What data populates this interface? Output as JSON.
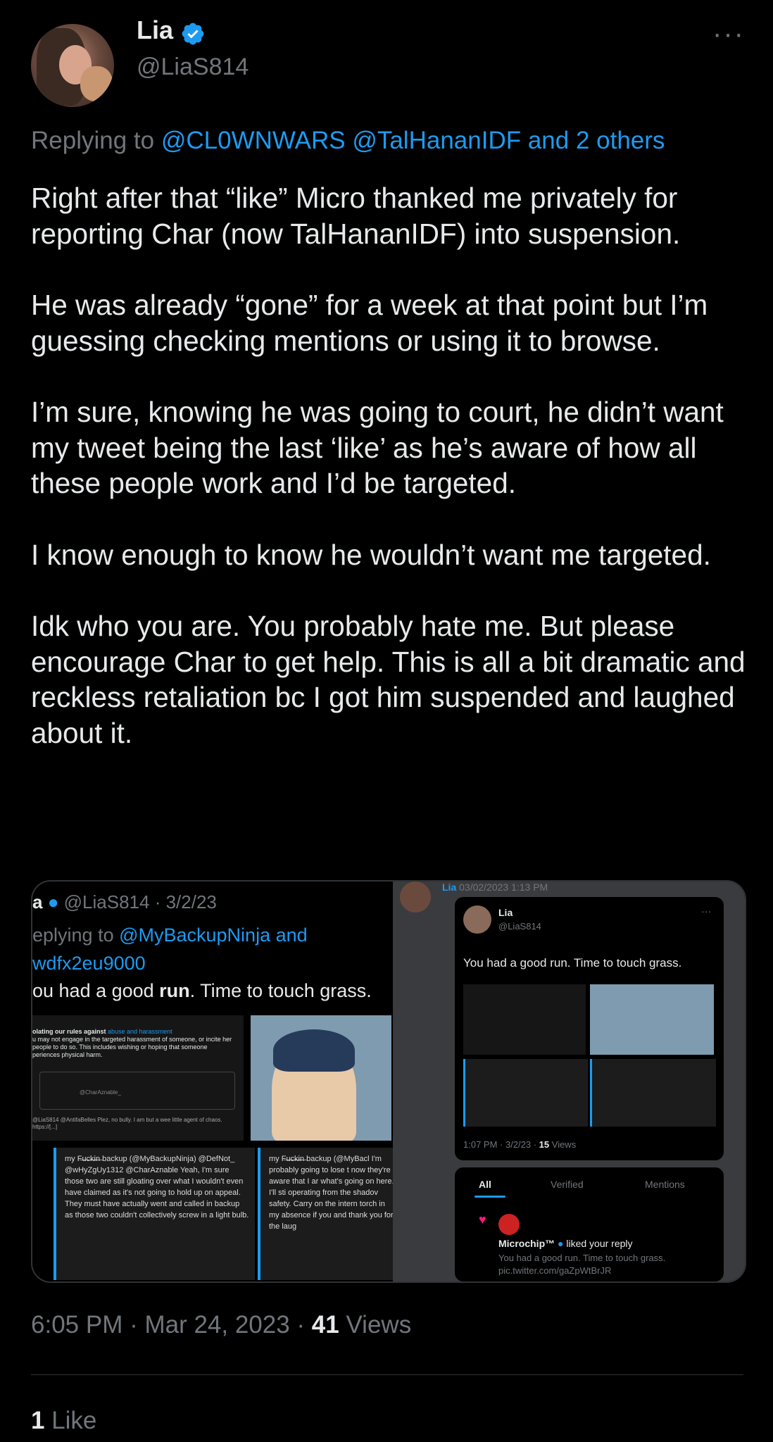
{
  "tweet": {
    "name": "Lia",
    "handle": "@LiaS814",
    "more_label": "···",
    "reply_prefix": "Replying to",
    "reply_mentions": "@CL0WNWARS @TalHananIDF and 2 others",
    "paragraphs": [
      "Right after that “like” Micro thanked me privately for reporting Char (now TalHananIDF) into suspension.",
      "He was already “gone” for a week at that point but I’m guessing checking mentions or using it to browse.",
      "I’m sure, knowing he was going to court, he didn’t want my tweet being the last ‘like’ as he’s aware of how all these people work and I’d be targeted.",
      "I know enough to know he wouldn’t want me targeted.",
      "Idk who you are. You probably hate me. But please encourage Char to get help. This is all a bit dramatic and reckless retaliation bc I got him suspended and laughed about it."
    ],
    "timestamp": "6:05 PM · Mar 24, 2023 · ",
    "views_count": "41",
    "views_label": " Views",
    "likes_count": "1",
    "likes_label": " Like",
    "accent_color": "#1d9bf0"
  },
  "media": {
    "left": {
      "header_name": "a",
      "header_meta": "@LiaS814 · 3/2/23",
      "reply_prefix": "eplying to ",
      "reply_link_1": "@MyBackupNinja and",
      "reply_link_2": "wdfx2eu9000",
      "text_prefix": "ou had a good ",
      "text_bold": "run",
      "text_suffix": ". Time to touch grass.",
      "rule_title": "olating our rules against ",
      "rule_link": "abuse and harassment",
      "rule_body": "u may not engage in the targeted harassment of someone, or incite her people to do so. This includes wishing or hoping that someone periences physical harm.",
      "box_handle": "@CharAznable_",
      "mini_text": "@LiaS814 @AntifaBelles Plez, no bully. I am but a wee little agent of chaos. https://[...]",
      "panel_b": "my F̶u̶c̶k̶i̶n̶ backup (@MyBackupNinja) @DefNot_ @wHyZgUy1312 @CharAznable Yeah, I'm sure those two are still gloating over what I wouldn't even have claimed as it's not going to hold up on appeal. They must have actually went and called in backup as those two couldn't collectively screw in a light bulb.",
      "panel_c": "my F̶u̶c̶k̶i̶n̶ backup (@MyBacl I'm probably going to lose t now they're aware that I ar what's going on here. I'll sti operating from the shadov safety. Carry on the intern torch in my absence if you and thank you for the laug"
    },
    "right": {
      "top_name": "Lia",
      "top_date": "03/02/2023 1:13 PM",
      "card_name": "Lia",
      "card_handle": "@LiaS814",
      "card_dots": "···",
      "card_text": "You had a good run. Time to touch grass.",
      "card_time": "1:07 PM · 3/2/23 · ",
      "card_views_count": "15",
      "card_views_label": " Views",
      "tabs": [
        "All",
        "Verified",
        "Mentions"
      ],
      "notif_name": "Microchip™",
      "notif_action": " liked your reply",
      "notif_text": "You had a good run. Time to touch grass.",
      "notif_link": "pic.twitter.com/gaZpWtBrJR"
    }
  }
}
